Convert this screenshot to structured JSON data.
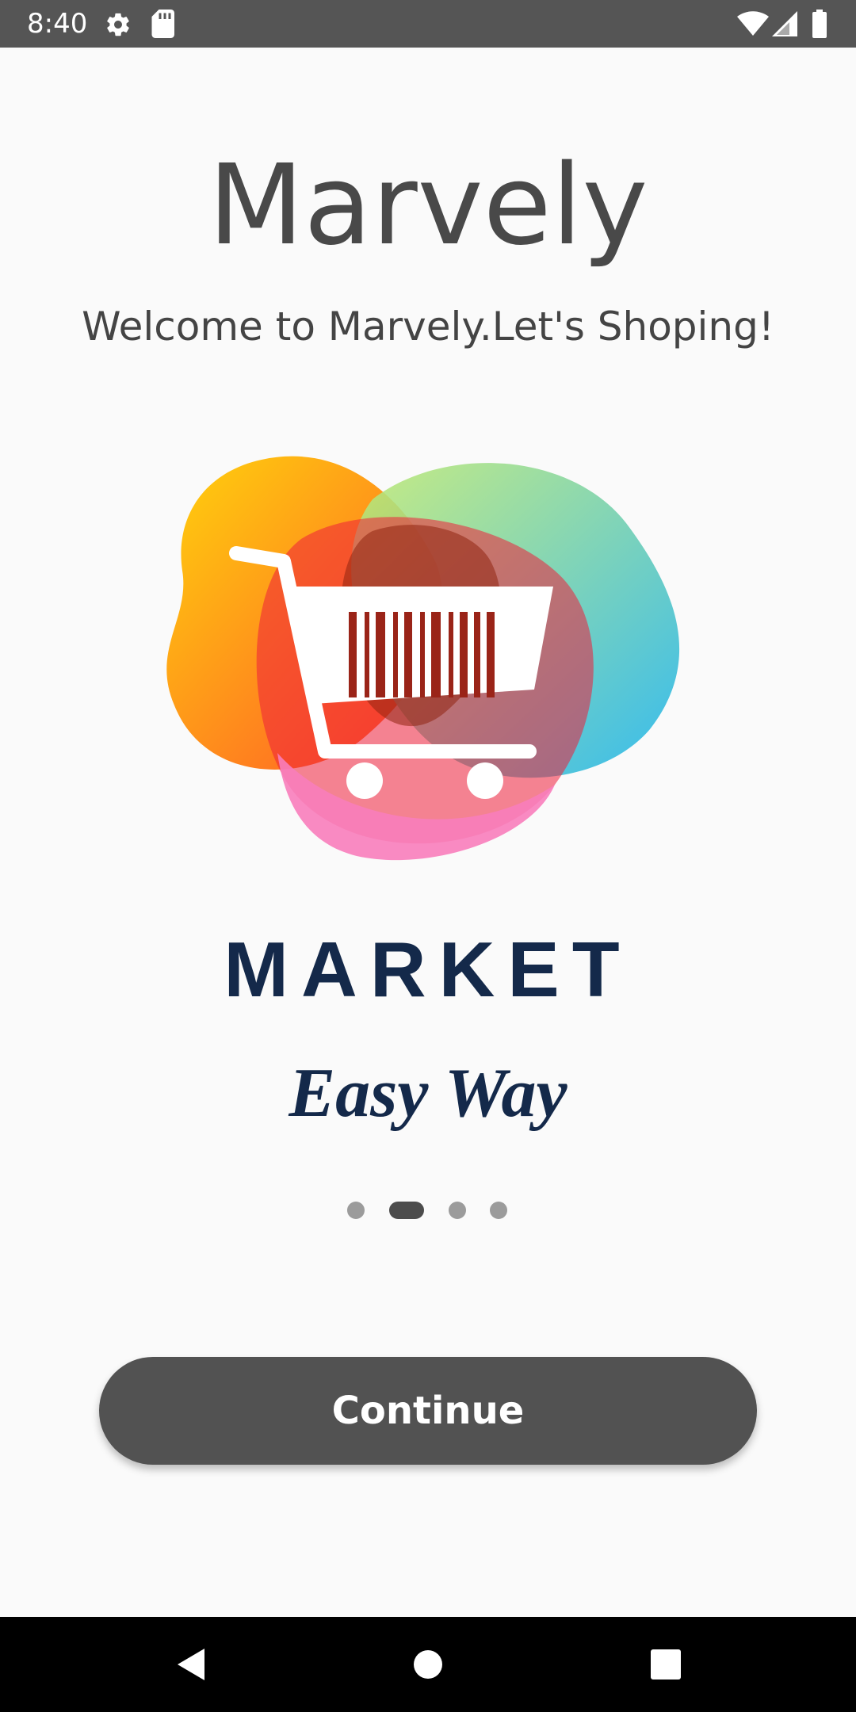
{
  "status_bar": {
    "time": "8:40",
    "icons": [
      "gear-icon",
      "sd-card-icon",
      "wifi-icon",
      "signal-icon",
      "battery-icon"
    ]
  },
  "header": {
    "title": "Marvely",
    "subtitle": "Welcome to Marvely.Let's Shoping!"
  },
  "illustration": {
    "brand_word": "MARKET",
    "tagline": "Easy Way",
    "brand_color": "#14294a"
  },
  "pager": {
    "count": 4,
    "active_index": 1
  },
  "actions": {
    "continue_label": "Continue",
    "button_color": "#525252"
  },
  "nav_bar": {
    "buttons": [
      "back-icon",
      "home-icon",
      "recents-icon"
    ]
  }
}
